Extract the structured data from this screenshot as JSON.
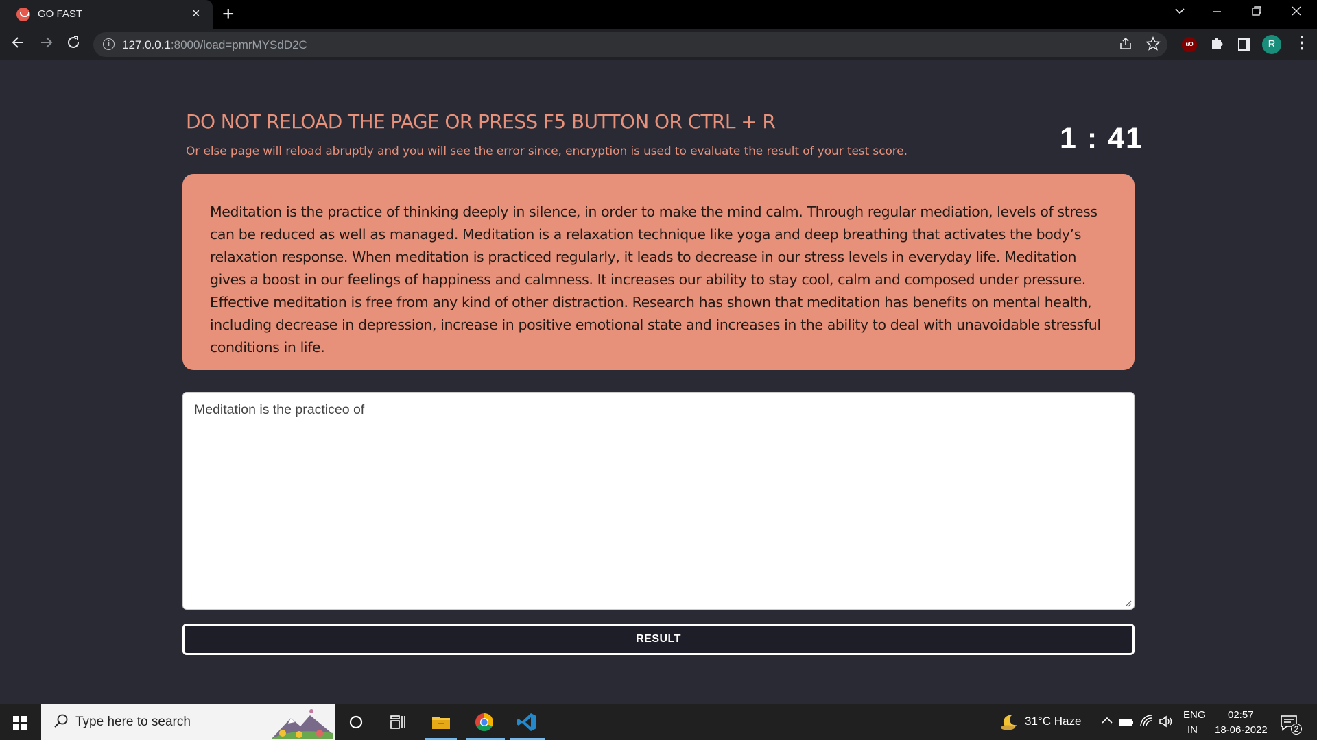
{
  "browser": {
    "tab_title": "GO FAST",
    "tab_close": "×",
    "new_tab": "+",
    "url_host": "127.0.0.1",
    "url_rest": ":8000/load=pmrMYSdD2C",
    "window_controls": [
      "minimize-icon",
      "restore-icon",
      "close-icon"
    ]
  },
  "page": {
    "warning_title": "DO NOT RELOAD THE PAGE OR PRESS F5 BUTTON OR CTRL + R",
    "warning_subtitle": "Or else page will reload abruptly and you will see the error since, encryption is used to evaluate the result of your test score.",
    "timer": "1 : 41",
    "passage": "Meditation is the practice of thinking deeply in silence, in order to make the mind calm. Through regular mediation, levels of stress can be reduced as well as managed. Meditation is a relaxation technique like yoga and deep breathing that activates the body’s relaxation response. When meditation is practiced regularly, it leads to decrease in our stress levels in everyday life. Meditation gives a boost in our feelings of happiness and calmness. It increases our ability to stay cool, calm and composed under pressure. Effective meditation is free from any kind of other distraction. Research has shown that meditation has benefits on mental health, including decrease in depression, increase in positive emotional state and increases in the ability to deal with unavoidable stressful conditions in life.",
    "typed_text": "Meditation is the practiceo of",
    "result_button": "RESULT",
    "colors": {
      "accent": "#e8917a",
      "background": "#2a2a35"
    }
  },
  "taskbar": {
    "search_placeholder": "Type here to search",
    "weather": "31°C  Haze",
    "language_line1": "ENG",
    "language_line2": "IN",
    "time": "02:57",
    "date": "18-06-2022",
    "notification_count": "2"
  }
}
